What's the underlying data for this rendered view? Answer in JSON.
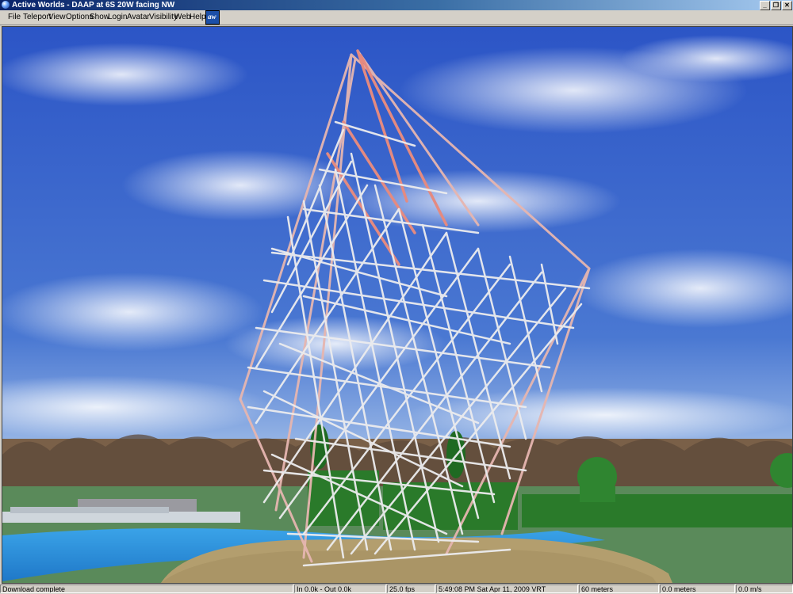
{
  "window": {
    "title": "Active Worlds - DAAP at 6S 20W facing NW",
    "minimize": "_",
    "restore": "❐",
    "close": "✕"
  },
  "menu": [
    "File",
    "Teleport",
    "View",
    "Options",
    "Show",
    "Login",
    "Avatar",
    "Visibility",
    "Web",
    "Help"
  ],
  "logo": "aw",
  "status": {
    "message": "Download complete",
    "transfer": "In  0.0k - Out  0.0k",
    "fps": "25.0 fps",
    "datetime": "5:49:08 PM Sat Apr 11, 2009 VRT",
    "distance": "60 meters",
    "altitude": "0.0 meters",
    "speed": "0.0 m/s"
  },
  "colors": {
    "sky_top": "#2c55c6",
    "sky_bottom": "#5b86d8",
    "grass": "#5a8a5a",
    "water": "#2c8fd8",
    "stone": "#b39e6e",
    "hedge": "#2a7a2a"
  }
}
